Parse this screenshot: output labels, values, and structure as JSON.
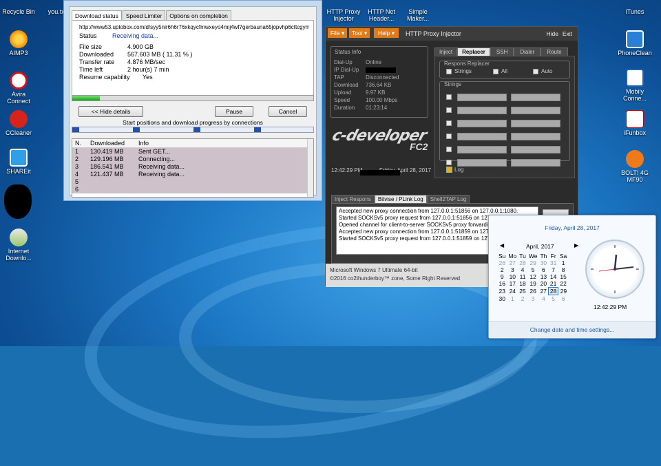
{
  "desktop_left_icons": [
    {
      "label": "Recycle Bin",
      "icon": "recycle-bin-icon"
    },
    {
      "label": "AIMP3",
      "icon": "aimp-icon"
    },
    {
      "label": "Avira Connect",
      "icon": "avira-icon"
    },
    {
      "label": "CCleaner",
      "icon": "ccleaner-icon"
    },
    {
      "label": "SHAREit",
      "icon": "shareit-icon"
    },
    {
      "label": "Internet Downlo...",
      "icon": "idm-icon"
    }
  ],
  "desktop_top_icons": [
    {
      "label": "you.txt"
    },
    {
      "label": "HTTP Proxy Injector"
    },
    {
      "label": "HTTP Net Header..."
    },
    {
      "label": "Simple Maker..."
    }
  ],
  "desktop_right_icons": [
    {
      "label": "iTunes"
    },
    {
      "label": "PhoneClean"
    },
    {
      "label": "Mobily Conne..."
    },
    {
      "label": "iFunbox"
    },
    {
      "label": "BOLT! 4G MF90"
    }
  ],
  "download": {
    "tabs": [
      "Download status",
      "Speed Limiter",
      "Options on completion"
    ],
    "url": "http://www53.uptobox.com/d/syy5nir6h6r76xkqycfmwxeyo4mij4wf7gerbauna65jopvhp6cttcgymnu4g",
    "status_label": "Status",
    "status_value": "Receiving data...",
    "file_size_label": "File size",
    "file_size": "4.900  GB",
    "downloaded_label": "Downloaded",
    "downloaded": "567.603  MB  ( 11.31 % )",
    "transfer_label": "Transfer rate",
    "transfer": "4.876  MB/sec",
    "time_left_label": "Time left",
    "time_left": "2 hour(s) 7 min",
    "resume_label": "Resume capability",
    "resume": "Yes",
    "progress": 0.1131,
    "hide_details": "<< Hide details",
    "pause": "Pause",
    "cancel": "Cancel",
    "connections_caption": "Start positions and download progress by connections",
    "table_headers": [
      "N.",
      "Downloaded",
      "Info"
    ],
    "rows": [
      {
        "n": "1",
        "dl": "130.419  MB",
        "info": "Sent GET..."
      },
      {
        "n": "2",
        "dl": "129.196  MB",
        "info": "Connecting..."
      },
      {
        "n": "3",
        "dl": "186.541  MB",
        "info": "Receiving data..."
      },
      {
        "n": "4",
        "dl": "121.437  MB",
        "info": "Receiving data..."
      },
      {
        "n": "5",
        "dl": "",
        "info": ""
      },
      {
        "n": "6",
        "dl": "",
        "info": ""
      }
    ]
  },
  "injector": {
    "menu": [
      "File ▾",
      "Tool ▾",
      "Help ▾"
    ],
    "title": "HTTP Proxy Injector",
    "hide": "Hide",
    "exit": "Exit",
    "status_title": "Status Info",
    "status_rows": [
      {
        "k": "Dial-Up",
        "v": "Online"
      },
      {
        "k": "IP Dial-Up",
        "v": ""
      },
      {
        "k": "TAP",
        "v": "Disconnected"
      },
      {
        "k": "Download",
        "v": "736.64 KB"
      },
      {
        "k": "Upload",
        "v": "9.97 KB"
      },
      {
        "k": "Speed",
        "v": "100.00 Mbps"
      },
      {
        "k": "Duration",
        "v": "01:23:14"
      }
    ],
    "logo_text": "c-developer",
    "logo_sub": "FC2",
    "time": "12:42:29 PM",
    "date": "Friday, April 28, 2017",
    "tabs": [
      "Inject",
      "Replacer",
      "SSH",
      "Dialer",
      "Route"
    ],
    "replacer_group": "Respons Replacer",
    "opt_strings": "Strings",
    "opt_all": "All",
    "opt_auto": "Auto",
    "strings_group": "Strings",
    "log_label": "Log",
    "log_tabs": [
      "Inject Respons",
      "Bitvise / PLink Log",
      "Shell2TAP Log"
    ],
    "log_lines": [
      "Accepted new proxy connection from 127.0.0.1:51856 on 127.0.0.1:1080.",
      "Started SOCKSv5 proxy request from 127.0.0.1:51856 on 127.0.0.1:1080",
      "Opened channel for client-to-server SOCKSv5 proxy forwarding",
      "Accepted new proxy connection from 127.0.0.1:51859 on 127.0.0.1:1080",
      "Started SOCKSv5 proxy request from 127.0.0.1:51859 on 127.0.0.1:1080"
    ],
    "os_line": "Microsoft Windows 7 Ultimate  64-bit",
    "copyright": "©2016  co2thunderboy™ zone, Some Right Reserved"
  },
  "calendar": {
    "header_date": "Friday, April 28, 2017",
    "month": "April, 2017",
    "days": [
      "Su",
      "Mo",
      "Tu",
      "We",
      "Th",
      "Fr",
      "Sa"
    ],
    "weeks": [
      [
        "26",
        "27",
        "28",
        "29",
        "30",
        "31",
        "1"
      ],
      [
        "2",
        "3",
        "4",
        "5",
        "6",
        "7",
        "8"
      ],
      [
        "9",
        "10",
        "11",
        "12",
        "13",
        "14",
        "15"
      ],
      [
        "16",
        "17",
        "18",
        "19",
        "20",
        "21",
        "22"
      ],
      [
        "23",
        "24",
        "25",
        "26",
        "27",
        "28",
        "29"
      ],
      [
        "30",
        "1",
        "2",
        "3",
        "4",
        "5",
        "6"
      ]
    ],
    "time": "12:42:29 PM",
    "settings_link": "Change date and time settings..."
  }
}
